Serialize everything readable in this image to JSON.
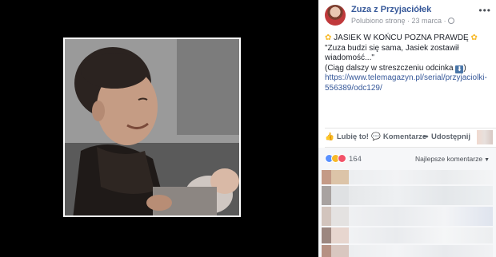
{
  "post": {
    "page_name": "Zuza z Przyjaciółek",
    "meta": "Polubiono stronę · 23 marca ·",
    "more_icon": "ellipsis-icon",
    "headline": "JASIEK W KOŃCU POZNA PRAWDĘ",
    "quote_line1": "\"Zuza budzi się sama, Jasiek zostawił",
    "quote_line2": "wiadomość...\"",
    "teaser": "(Ciąg dalszy w streszczeniu odcinka",
    "teaser_end": ")",
    "link_line1": "https://www.telemagazyn.pl/serial/przyjaciolki-",
    "link_line2": "556389/odc129/"
  },
  "actions": {
    "like": "Lubię to!",
    "comment": "Komentarze",
    "share": "Udostępnij"
  },
  "reactions": {
    "count": "164",
    "sort": "Najlepsze komentarze"
  },
  "colors": {
    "link": "#365899",
    "background_viewer": "#000000",
    "panel_bg": "#ffffff",
    "comments_bg": "#f6f7f9"
  }
}
